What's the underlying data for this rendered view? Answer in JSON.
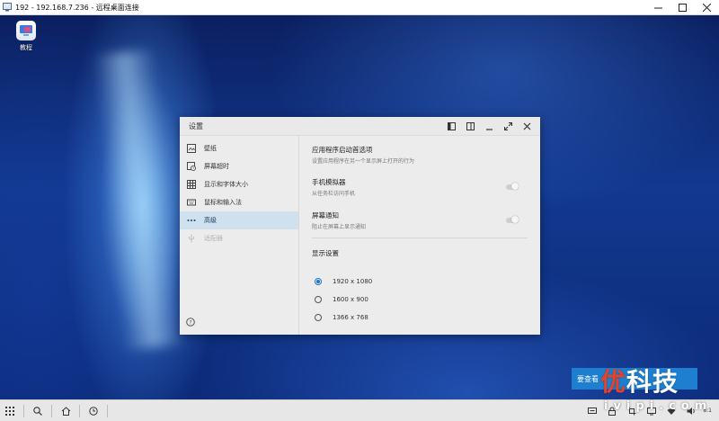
{
  "host": {
    "title": "192 - 192.168.7.236 - 远程桌面连接",
    "controls": [
      "minimize",
      "maximize",
      "close"
    ]
  },
  "desktop": {
    "icon_label": "教程"
  },
  "settings": {
    "title": "设置",
    "sidebar": [
      {
        "label": "壁纸",
        "icon": "wallpaper-icon",
        "state": "normal"
      },
      {
        "label": "屏幕超时",
        "icon": "screen-timeout-icon",
        "state": "normal"
      },
      {
        "label": "显示和字体大小",
        "icon": "display-font-icon",
        "state": "normal"
      },
      {
        "label": "鼠标和输入法",
        "icon": "keyboard-icon",
        "state": "normal"
      },
      {
        "label": "高级",
        "icon": "more-dots-icon",
        "state": "active"
      },
      {
        "label": "适配器",
        "icon": "adapter-icon",
        "state": "disabled"
      }
    ],
    "content": {
      "launch_title": "应用程序启动首选项",
      "launch_desc": "设置应用程序在另一个显示屏上打开的行为",
      "phone_emulator_title": "手机模拟器",
      "phone_emulator_desc": "从任务栏访问手机",
      "phone_emulator_on": false,
      "notifications_title": "屏幕通知",
      "notifications_desc": "阻止在屏幕上显示通知",
      "notifications_on": false,
      "display_title": "显示设置",
      "resolutions": [
        "1920 x 1080",
        "1600 x 900",
        "1366 x 768"
      ],
      "selected_resolution": "1920 x 1080"
    }
  },
  "overlay": {
    "promo_text": "要查看",
    "logo_mark": "优",
    "logo_text": "科技",
    "logo_sub": "ivipi.com"
  },
  "taskbar": {
    "time_text": "8:1"
  },
  "colors": {
    "accent": "#1b74c7",
    "active_item_bg": "#cfe0ee",
    "window_bg": "#ececec"
  }
}
